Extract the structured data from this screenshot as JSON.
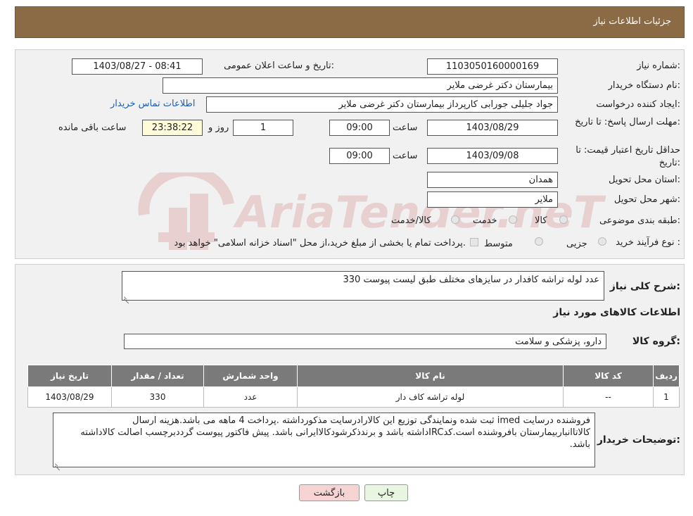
{
  "header": {
    "title": "جزئیات اطلاعات نیاز"
  },
  "form": {
    "need_number_label": "شماره نیاز:",
    "need_number": "1103050160000169",
    "announce_label": "تاریخ و ساعت اعلان عمومی:",
    "announce_value": "1403/08/27 - 08:41",
    "buyer_org_label": "نام دستگاه خریدار:",
    "buyer_org": "بیمارستان دکتر غرضی ملایر",
    "creator_label": "ایجاد کننده درخواست:",
    "creator": "جواد جلیلی جورابی کارپرداز بیمارستان دکتر غرضی ملایر",
    "contact_link": "اطلاعات تماس خریدار",
    "deadline_label": "مهلت ارسال پاسخ: تا تاریخ:",
    "deadline_date": "1403/08/29",
    "time_label": "ساعت",
    "deadline_time": "09:00",
    "days": "1",
    "days_label": "روز و",
    "remaining": "23:38:22",
    "remaining_label": "ساعت باقی مانده",
    "validity_label": "حداقل تاریخ اعتبار قیمت: تا تاریخ:",
    "validity_date": "1403/09/08",
    "validity_time": "09:00",
    "province_label": "استان محل تحویل:",
    "province": "همدان",
    "city_label": "شهر محل تحویل:",
    "city": "ملایر",
    "category_label": "طبقه بندی موضوعی:",
    "category_options": [
      "کالا",
      "خدمت",
      "کالا/خدمت"
    ],
    "process_label": "نوع فرآیند خرید :",
    "process_options": [
      "جزیی",
      "متوسط"
    ],
    "process_note": "پرداخت تمام یا بخشی از مبلغ خرید،از محل \"اسناد خزانه اسلامی\" خواهد بود."
  },
  "details": {
    "summary_label": "شرح کلی نیاز:",
    "summary": "330 عدد لوله تراشه کافدار در سایزهای مختلف طبق لیست پیوست",
    "goods_info_title": "اطلاعات کالاهای مورد نیاز",
    "group_label": "گروه کالا:",
    "group": "دارو، پزشکی و سلامت",
    "table": {
      "headers": [
        "ردیف",
        "کد کالا",
        "نام کالا",
        "واحد شمارش",
        "تعداد / مقدار",
        "تاریخ نیاز"
      ],
      "rows": [
        [
          "1",
          "--",
          "لوله تراشه کاف دار",
          "عدد",
          "330",
          "1403/08/29"
        ]
      ]
    },
    "buyer_notes_label": "توضیحات خریدار:",
    "buyer_notes": "فروشنده درسایت imed ثبت شده ونمایندگی توزیع این کالارادرسایت مذکورداشته .پرداخت 4 ماهه می باشد.هزینه ارسال کالاتاانباربیمارستان بافروشنده است.کدIRCداشته باشد و برندذکرشودکالاایرانی باشد. پیش فاکتور پیوست گرددبرچسب اصالت کالاداشته باشد."
  },
  "buttons": {
    "print": "چاپ",
    "back": "بازگشت"
  },
  "watermark": {
    "text": "AriaTender.neT"
  },
  "colors": {
    "header_bg": "#8b6b45",
    "table_header_bg": "#7a7a7a",
    "back_button_bg": "#f7d4d4",
    "print_button_bg": "#e8f5e0",
    "link": "#1a5fb4"
  }
}
